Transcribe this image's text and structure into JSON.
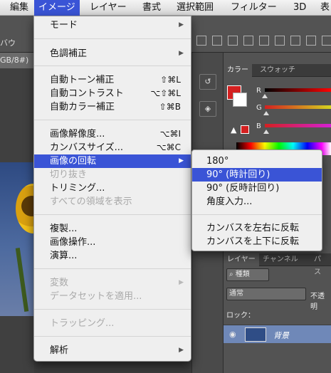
{
  "menubar": {
    "items": [
      "編集",
      "イメージ",
      "レイヤー",
      "書式",
      "選択範囲",
      "フィルター",
      "3D",
      "表"
    ],
    "active_index": 1
  },
  "background": {
    "options_partial_label": "バウ",
    "doc_tab_partial": "GB/8#)",
    "panel_tabs_top": [
      "カラー",
      "スウォッチ"
    ],
    "color_channels": [
      "R",
      "G",
      "B"
    ],
    "panel_tabs_layers": [
      "レイヤー",
      "チャンネル",
      "パス"
    ],
    "layer_search_label": "種類",
    "blend_mode": "通常",
    "opacity_label": "不透明",
    "lock_label": "ロック：",
    "layer_name": "背景",
    "colors": {
      "foreground": "#d42020",
      "background": "#ffffff",
      "highlight": "#3a54d6"
    }
  },
  "image_menu": {
    "items": [
      {
        "label": "モード",
        "submenu": true
      },
      {
        "label": "色調補正",
        "submenu": true
      },
      {
        "label": "自動トーン補正",
        "shortcut": "⇧⌘L"
      },
      {
        "label": "自動コントラスト",
        "shortcut": "⌥⇧⌘L"
      },
      {
        "label": "自動カラー補正",
        "shortcut": "⇧⌘B"
      },
      {
        "label": "画像解像度...",
        "shortcut": "⌥⌘I"
      },
      {
        "label": "カンバスサイズ...",
        "shortcut": "⌥⌘C"
      },
      {
        "label": "画像の回転",
        "submenu": true,
        "highlighted": true
      },
      {
        "label": "切り抜き",
        "disabled": true
      },
      {
        "label": "トリミング..."
      },
      {
        "label": "すべての領域を表示",
        "disabled": true
      },
      {
        "label": "複製..."
      },
      {
        "label": "画像操作..."
      },
      {
        "label": "演算..."
      },
      {
        "label": "変数",
        "submenu": true,
        "disabled": true
      },
      {
        "label": "データセットを適用...",
        "disabled": true
      },
      {
        "label": "トラッピング...",
        "disabled": true
      },
      {
        "label": "解析",
        "submenu": true
      }
    ]
  },
  "rotate_submenu": {
    "items": [
      {
        "label": "180°"
      },
      {
        "label": "90° (時計回り)",
        "highlighted": true
      },
      {
        "label": "90° (反時計回り)"
      },
      {
        "label": "角度入力..."
      },
      {
        "label": "カンバスを左右に反転"
      },
      {
        "label": "カンバスを上下に反転"
      }
    ]
  }
}
